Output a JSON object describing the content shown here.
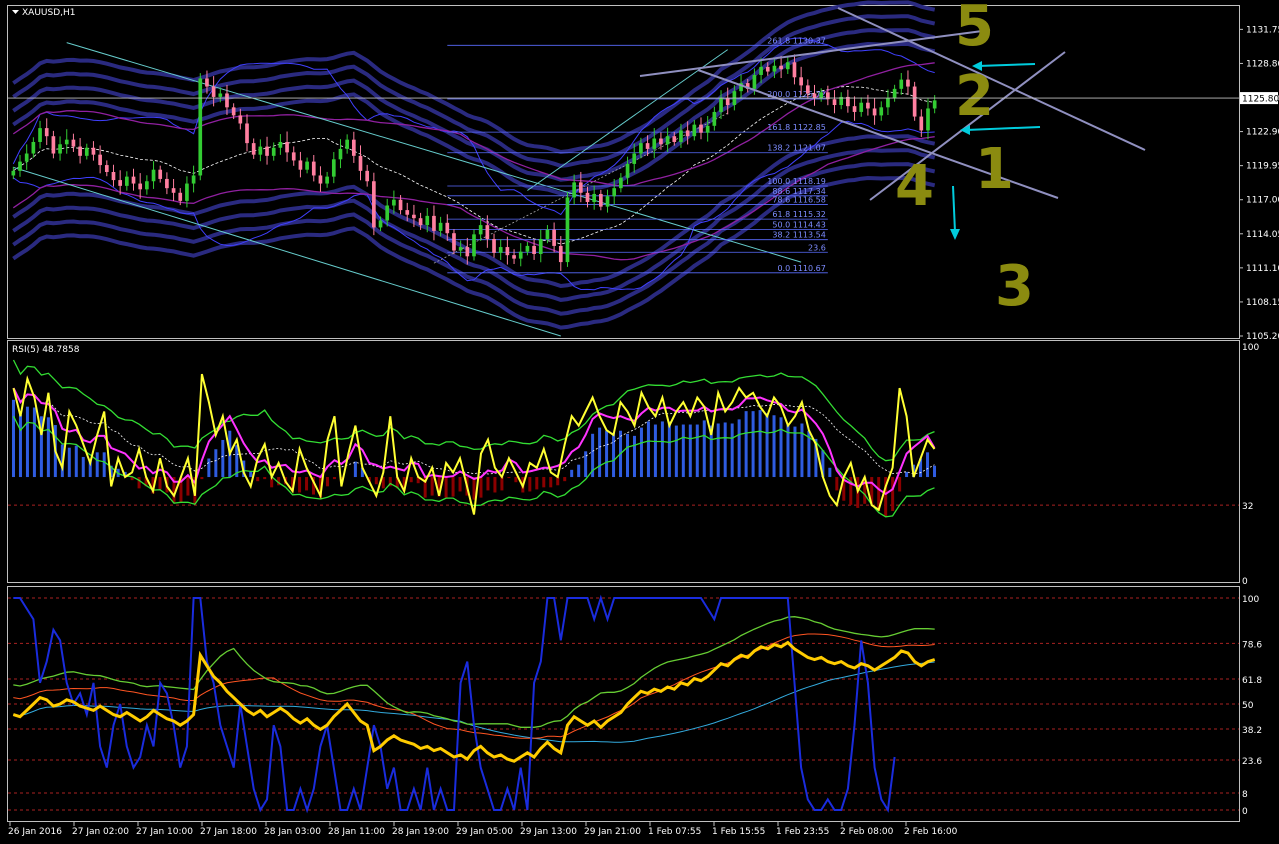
{
  "window": {
    "title": "XAUUSD,H1"
  },
  "colors": {
    "bg": "#000000",
    "frame": "#c0c0c0",
    "bull": "#33cc33",
    "bear": "#ff7fa0",
    "fib": "#5a6cff",
    "band": "#2a2a80",
    "bollinger": "#4040ff",
    "envelope": "#9020a0",
    "rsi_main": "#ffff33",
    "rsi_signal": "#ff33ff",
    "rsi_band": "#33dd33",
    "hist_pos": "#2f5ce0",
    "hist_neg": "#8b0000",
    "stoch_main": "#ffcc00",
    "stoch_blue": "#1a2cdd",
    "annotation": "#8b8b10",
    "arrow": "#00ccdd",
    "handline": "#9090c0"
  },
  "chart_data": [
    {
      "type": "candlestick",
      "title": "XAUUSD,H1",
      "symbol": "XAUUSD",
      "timeframe": "H1",
      "current_price": 1125.8,
      "ylim": [
        1105.2,
        1133.6
      ],
      "price_ticks": [
        1131.75,
        1128.8,
        1125.8,
        1122.9,
        1119.95,
        1117.0,
        1114.05,
        1111.1,
        1108.15,
        1105.2
      ],
      "price_tick_labels": [
        "1131.75",
        "1128.80",
        "1125.80",
        "1122.90",
        "1119.95",
        "1117.00",
        "1114.05",
        "1111.10",
        "1108.15",
        "1105.20"
      ],
      "x_labels": [
        "26 Jan 2016",
        "27 Jan 02:00",
        "27 Jan 10:00",
        "27 Jan 18:00",
        "28 Jan 03:00",
        "28 Jan 11:00",
        "28 Jan 19:00",
        "29 Jan 05:00",
        "29 Jan 13:00",
        "29 Jan 21:00",
        "1 Feb 07:55",
        "1 Feb 15:55",
        "1 Feb 23:55",
        "2 Feb 08:00",
        "2 Feb 16:00"
      ],
      "close": [
        1119.5,
        1120.3,
        1121.0,
        1122.0,
        1123.2,
        1122.5,
        1121.0,
        1121.8,
        1122.2,
        1121.6,
        1120.8,
        1121.5,
        1120.9,
        1120.0,
        1119.4,
        1118.7,
        1118.2,
        1119.0,
        1118.4,
        1117.9,
        1118.6,
        1119.6,
        1118.8,
        1118.0,
        1117.6,
        1116.9,
        1118.4,
        1119.1,
        1127.5,
        1126.8,
        1125.9,
        1126.2,
        1125.0,
        1124.3,
        1123.6,
        1121.9,
        1120.9,
        1121.6,
        1120.8,
        1121.5,
        1122.0,
        1121.1,
        1120.4,
        1119.6,
        1120.3,
        1119.1,
        1118.4,
        1119.0,
        1120.5,
        1121.4,
        1122.2,
        1120.8,
        1119.5,
        1118.6,
        1114.6,
        1115.2,
        1116.5,
        1117.0,
        1116.1,
        1115.7,
        1115.4,
        1114.8,
        1115.6,
        1114.3,
        1115.0,
        1114.1,
        1112.6,
        1112.9,
        1112.1,
        1114.0,
        1114.8,
        1113.6,
        1112.4,
        1112.9,
        1112.2,
        1111.9,
        1112.5,
        1113.0,
        1112.3,
        1113.6,
        1114.4,
        1113.0,
        1111.6,
        1117.2,
        1118.5,
        1117.6,
        1116.8,
        1117.5,
        1116.4,
        1117.3,
        1118.0,
        1118.9,
        1120.1,
        1121.0,
        1121.9,
        1121.4,
        1122.3,
        1121.8,
        1122.5,
        1122.0,
        1123.0,
        1122.5,
        1123.5,
        1122.8,
        1123.4,
        1124.6,
        1125.8,
        1125.2,
        1126.4,
        1127.1,
        1126.6,
        1127.8,
        1128.5,
        1128.1,
        1128.6,
        1128.3,
        1128.9,
        1127.6,
        1126.9,
        1126.2,
        1125.8,
        1126.3,
        1125.7,
        1125.2,
        1125.9,
        1125.1,
        1124.6,
        1125.4,
        1124.9,
        1124.3,
        1125.0,
        1125.8,
        1126.6,
        1127.4,
        1126.8,
        1124.2,
        1123.0,
        1124.9,
        1125.6
      ],
      "fib_levels": [
        {
          "label": "261.8 1130.37",
          "price": 1130.37
        },
        {
          "label": "200.0 1125.72",
          "price": 1125.72
        },
        {
          "label": "161.8 1122.85",
          "price": 1122.85
        },
        {
          "label": "138.2 1121.07",
          "price": 1121.07
        },
        {
          "label": "100.0 1118.19",
          "price": 1118.19
        },
        {
          "label": "88.6 1117.34",
          "price": 1117.34
        },
        {
          "label": "78.6 1116.58",
          "price": 1116.58
        },
        {
          "label": "61.8 1115.32",
          "price": 1115.32
        },
        {
          "label": "50.0 1114.43",
          "price": 1114.43
        },
        {
          "label": "38.2 1113.54",
          "price": 1113.54
        },
        {
          "label": "23.6",
          "price": 1112.45
        },
        {
          "label": "0.0 1110.67",
          "price": 1110.67
        }
      ],
      "annotations": [
        "5",
        "2",
        "1",
        "4",
        "3"
      ]
    },
    {
      "type": "line",
      "title": "RSI(5) 48.7858",
      "ylim": [
        0,
        100
      ],
      "level_labels": [
        "100",
        "32",
        "0"
      ],
      "level_values": [
        100,
        32,
        0
      ],
      "series": [
        {
          "name": "RSI(5)",
          "values": [
            82,
            70,
            86,
            78,
            62,
            80,
            55,
            48,
            72,
            66,
            58,
            50,
            62,
            72,
            40,
            52,
            44,
            46,
            56,
            44,
            38,
            52,
            40,
            36,
            44,
            52,
            36,
            88,
            76,
            62,
            70,
            54,
            60,
            46,
            40,
            52,
            58,
            44,
            50,
            42,
            38,
            56,
            48,
            42,
            36,
            60,
            70,
            40,
            54,
            66,
            48,
            42,
            36,
            46,
            70,
            44,
            38,
            52,
            44,
            42,
            48,
            36,
            50,
            46,
            52,
            40,
            28,
            54,
            60,
            48,
            44,
            52,
            46,
            40,
            50,
            48,
            56,
            46,
            44,
            58,
            70,
            66,
            72,
            78,
            70,
            64,
            62,
            76,
            72,
            66,
            80,
            74,
            70,
            78,
            66,
            72,
            76,
            70,
            78,
            74,
            62,
            80,
            72,
            76,
            82,
            78,
            80,
            74,
            70,
            78,
            74,
            66,
            70,
            76,
            64,
            58,
            44,
            36,
            32,
            44,
            50,
            38,
            44,
            32,
            30,
            40,
            48,
            82,
            70,
            44,
            52,
            60,
            56
          ]
        }
      ]
    },
    {
      "type": "line",
      "title": "",
      "ylim": [
        0,
        100
      ],
      "level_labels": [
        "100",
        "78.6",
        "61.8",
        "50",
        "38.2",
        "23.6",
        "8",
        "0"
      ],
      "level_values": [
        100,
        78.6,
        61.8,
        50,
        38.2,
        23.6,
        8,
        0
      ],
      "series": [
        {
          "name": "",
          "values": [
            45,
            44,
            47,
            50,
            53,
            52,
            49,
            50,
            52,
            51,
            49,
            48,
            47,
            49,
            47,
            45,
            44,
            46,
            44,
            42,
            44,
            47,
            45,
            43,
            42,
            40,
            42,
            45,
            73,
            68,
            63,
            60,
            56,
            53,
            50,
            47,
            45,
            47,
            44,
            46,
            48,
            46,
            43,
            41,
            43,
            40,
            38,
            40,
            44,
            47,
            50,
            46,
            42,
            40,
            28,
            30,
            33,
            35,
            33,
            32,
            31,
            29,
            30,
            28,
            29,
            27,
            25,
            26,
            24,
            28,
            30,
            27,
            25,
            26,
            24,
            23,
            25,
            27,
            25,
            29,
            32,
            29,
            27,
            40,
            44,
            42,
            40,
            42,
            39,
            42,
            44,
            46,
            50,
            53,
            56,
            55,
            57,
            56,
            58,
            57,
            60,
            59,
            62,
            61,
            63,
            66,
            69,
            68,
            71,
            73,
            72,
            75,
            77,
            76,
            78,
            77,
            79,
            76,
            74,
            72,
            71,
            72,
            70,
            69,
            70,
            68,
            67,
            69,
            68,
            66,
            68,
            70,
            72,
            75,
            74,
            70,
            68,
            70,
            71
          ]
        },
        {
          "name": "",
          "values": [
            100,
            100,
            95,
            90,
            60,
            70,
            85,
            80,
            60,
            50,
            55,
            45,
            60,
            30,
            20,
            40,
            50,
            30,
            20,
            25,
            40,
            30,
            60,
            55,
            40,
            20,
            30,
            100,
            100,
            70,
            60,
            40,
            30,
            20,
            50,
            30,
            10,
            0,
            5,
            40,
            30,
            0,
            0,
            10,
            0,
            10,
            30,
            40,
            20,
            0,
            0,
            10,
            0,
            20,
            40,
            30,
            10,
            20,
            0,
            0,
            10,
            0,
            20,
            0,
            10,
            0,
            0,
            60,
            70,
            40,
            20,
            10,
            0,
            0,
            10,
            0,
            20,
            0,
            60,
            70,
            100,
            100,
            80,
            100,
            100,
            100,
            100,
            90,
            100,
            90,
            100,
            100,
            100,
            100,
            100,
            100,
            100,
            100,
            100,
            100,
            100,
            100,
            100,
            100,
            95,
            90,
            100,
            100,
            100,
            100,
            100,
            100,
            100,
            100,
            100,
            100,
            100,
            60,
            20,
            5,
            0,
            0,
            5,
            0,
            0,
            10,
            40,
            80,
            60,
            20,
            5,
            0,
            25
          ]
        }
      ]
    }
  ]
}
